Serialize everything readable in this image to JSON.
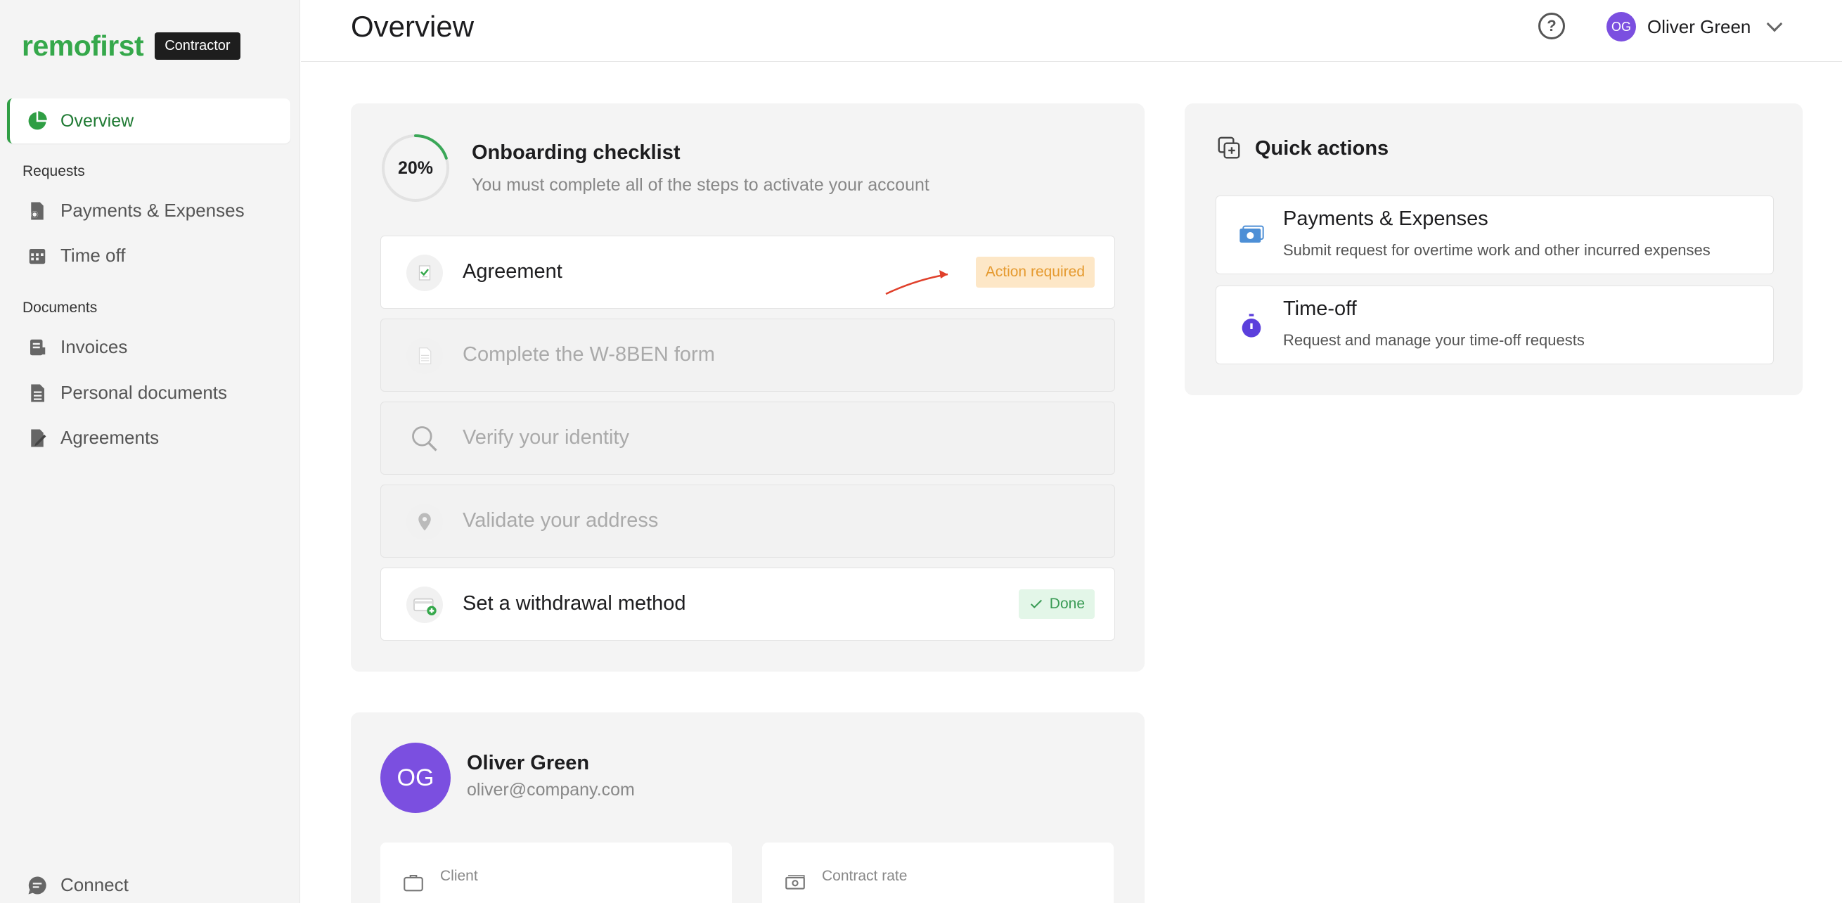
{
  "brand": {
    "logo": "remofirst",
    "badge": "Contractor"
  },
  "sidebar": {
    "active": {
      "label": "Overview",
      "icon": "pie-chart-icon"
    },
    "sections": [
      {
        "title": "Requests",
        "items": [
          {
            "label": "Payments & Expenses",
            "icon": "payment-icon"
          },
          {
            "label": "Time off",
            "icon": "calendar-icon"
          }
        ]
      },
      {
        "title": "Documents",
        "items": [
          {
            "label": "Invoices",
            "icon": "invoice-icon"
          },
          {
            "label": "Personal documents",
            "icon": "document-icon"
          },
          {
            "label": "Agreements",
            "icon": "agreement-icon"
          }
        ]
      }
    ],
    "bottom": {
      "label": "Connect",
      "icon": "chat-icon"
    }
  },
  "header": {
    "title": "Overview",
    "user_initials": "OG",
    "user_name": "Oliver Green"
  },
  "checklist": {
    "progress": "20%",
    "progress_value": 0.2,
    "title": "Onboarding checklist",
    "subtitle": "You must complete all of the steps to activate your account",
    "steps": [
      {
        "label": "Agreement",
        "badge": "Action required",
        "icon": "agreement-check-icon"
      },
      {
        "label": "Complete the W-8BEN form",
        "icon": "form-icon"
      },
      {
        "label": "Verify your identity",
        "icon": "magnifier-icon"
      },
      {
        "label": "Validate your address",
        "icon": "location-pin-icon"
      },
      {
        "label": "Set a withdrawal method",
        "badge": "Done",
        "icon": "card-icon"
      }
    ]
  },
  "profile": {
    "initials": "OG",
    "name": "Oliver Green",
    "email": "oliver@company.com",
    "boxes": [
      {
        "label": "Client",
        "icon": "briefcase-icon"
      },
      {
        "label": "Contract rate",
        "icon": "money-icon"
      }
    ]
  },
  "quick_actions": {
    "title": "Quick actions",
    "items": [
      {
        "title": "Payments & Expenses",
        "desc": "Submit request for overtime work and other incurred expenses",
        "icon": "payments-icon"
      },
      {
        "title": "Time-off",
        "desc": "Request and manage your time-off requests",
        "icon": "stopwatch-icon"
      }
    ]
  }
}
